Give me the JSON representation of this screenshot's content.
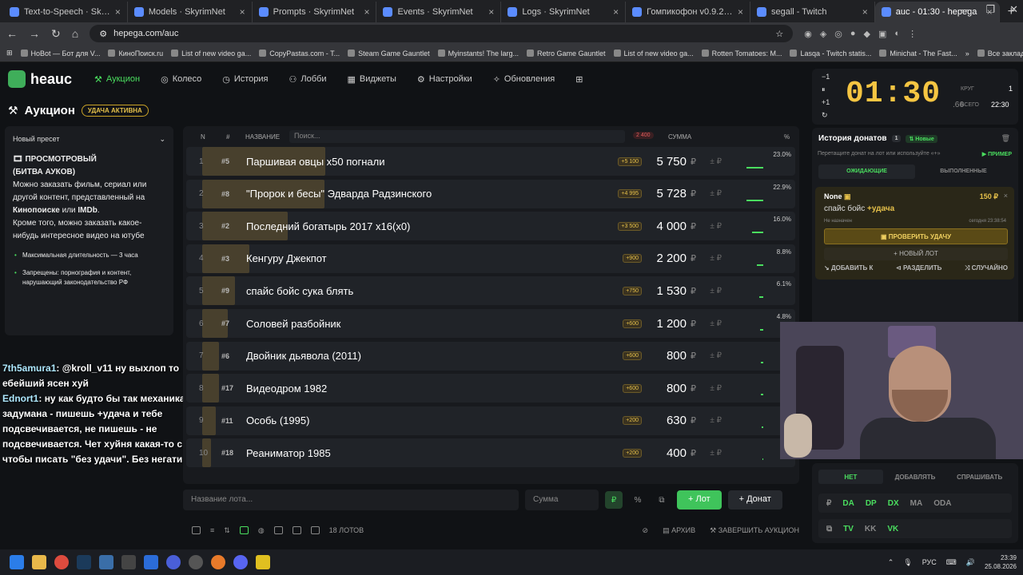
{
  "tabs": [
    {
      "title": "Text-to-Speech · SkyrimNet",
      "active": false
    },
    {
      "title": "Models · SkyrimNet",
      "active": false
    },
    {
      "title": "Prompts · SkyrimNet",
      "active": false
    },
    {
      "title": "Events · SkyrimNet",
      "active": false
    },
    {
      "title": "Logs · SkyrimNet",
      "active": false
    },
    {
      "title": "Гомпикофон v0.9.24.1 —",
      "active": false
    },
    {
      "title": "segall - Twitch",
      "active": false
    },
    {
      "title": "auc - 01:30 - hepega",
      "active": true
    }
  ],
  "url": "hepega.com/auc",
  "bookmarks": [
    "HoBot — Бот для V...",
    "КиноПоиск.ru",
    "List of new video ga...",
    "CopyPastas.com - T...",
    "Steam Game Gauntlet",
    "Myinstants! The larg...",
    "Retro Game Gauntlet",
    "List of new video ga...",
    "Rotten Tomatoes: M...",
    "Lasqa - Twitch statis...",
    "Minichat - The Fast..."
  ],
  "all_bookmarks": "Все закладки",
  "app": {
    "logo": "heauc",
    "nav": [
      "Аукцион",
      "Колесо",
      "История",
      "Лобби",
      "Виджеты",
      "Настройки",
      "Обновления"
    ],
    "page_title": "Аукцион",
    "luck_badge": "УДАЧА АКТИВНА"
  },
  "preset": {
    "name": "Новый пресет",
    "title1": "ПРОСМОТРОВЫЙ",
    "title2": "(БИТВА АУКОВ)",
    "text1": "Можно заказать фильм, сериал или другой контент, представленный на",
    "kp": "Кинопоиске",
    "or": "или",
    "imdb": "IMDb",
    "text2": "Кроме того, можно заказать какое-нибудь интересное видео на ютубе",
    "rule1": "Максимальная длительность — 3 часа",
    "rule2": "Запрещены: порнография и контент, нарушающий законодательство РФ"
  },
  "chat": [
    {
      "user": "7th5amura1",
      "text": "@kroll_v11 ну выхлоп то ебейший ясен хуй"
    },
    {
      "user": "Ednort1",
      "text": "ну как будто бы так механика и задумана - пишешь +удача и тебе подсвечивается, не пишешь - не подсвечивается. Чет хуйня какая-то с тем, чтобы писать \"без удачи\". Без негатива"
    }
  ],
  "table": {
    "headers": {
      "n": "N",
      "id": "#",
      "name": "НАЗВАНИЕ",
      "search": "Поиск...",
      "total": "2 400",
      "sum": "СУММА",
      "pct": "%"
    },
    "rows": [
      {
        "n": "1",
        "id": "#5",
        "name": "Паршивая овцы x50 погнали",
        "add": "+5 100",
        "amount": "5 750",
        "pct": "23.0%",
        "share": 0.23
      },
      {
        "n": "2",
        "id": "#8",
        "name": "\"Пророк и бесы\" Эдварда Радзинского",
        "add": "+4 995",
        "amount": "5 728",
        "pct": "22.9%",
        "share": 0.229
      },
      {
        "n": "3",
        "id": "#2",
        "name": "Последний богатырь 2017 x16(x0)",
        "add": "+3 500",
        "amount": "4 000",
        "pct": "16.0%",
        "share": 0.16
      },
      {
        "n": "4",
        "id": "#3",
        "name": "Кенгуру Джекпот",
        "add": "+900",
        "amount": "2 200",
        "pct": "8.8%",
        "share": 0.088
      },
      {
        "n": "5",
        "id": "#9",
        "name": "спайс бойс сука блять",
        "add": "+750",
        "amount": "1 530",
        "pct": "6.1%",
        "share": 0.061
      },
      {
        "n": "6",
        "id": "#7",
        "name": "Соловей разбойник",
        "add": "+600",
        "amount": "1 200",
        "pct": "4.8%",
        "share": 0.048
      },
      {
        "n": "7",
        "id": "#6",
        "name": "Двойник дьявола (2011)",
        "add": "+600",
        "amount": "800",
        "pct": "3.2",
        "share": 0.032
      },
      {
        "n": "8",
        "id": "#17",
        "name": "Видеодром 1982",
        "add": "+600",
        "amount": "800",
        "pct": "3.2",
        "share": 0.032
      },
      {
        "n": "9",
        "id": "#11",
        "name": "Особь (1995)",
        "add": "+200",
        "amount": "630",
        "pct": "2.5",
        "share": 0.025
      },
      {
        "n": "10",
        "id": "#18",
        "name": "Реаниматор 1985",
        "add": "+200",
        "amount": "400",
        "pct": "1.6",
        "share": 0.016
      }
    ],
    "currency": "₽",
    "plus": "± ₽"
  },
  "add_row": {
    "lot_placeholder": "Название лота...",
    "sum_placeholder": "Сумма",
    "cur1": "₽",
    "cur2": "%",
    "lot_btn": "+ Лот",
    "donat_btn": "+ Донат"
  },
  "footer": {
    "lots": "18 ЛОТОВ",
    "archive": "АРХИВ",
    "finish": "ЗАВЕРШИТЬ АУКЦИОН"
  },
  "timer": {
    "minus": "−1",
    "pause": "⏸",
    "plus": "+1",
    "value": "01:30",
    "ms": ".66",
    "round_label": "КРУГ",
    "round": "1",
    "total_label": "ВСЕГО",
    "total": "22:30"
  },
  "donations": {
    "title": "История донатов",
    "count": "1",
    "new": "Новые",
    "hint": "Перетащите донат на лот или используйте «+»",
    "example": "▶ ПРИМЕР",
    "tab_wait": "ОЖИДАЮЩИЕ",
    "tab_done": "ВЫПОЛНЕННЫЕ",
    "card": {
      "name": "None",
      "sum": "150 ₽",
      "msg": "спайс бойс",
      "luck": "+удача",
      "status": "Не назначен",
      "time": "сегодня 23:38:54",
      "check": "ПРОВЕРИТЬ УДАЧУ",
      "new_lot": "+ НОВЫЙ ЛОТ",
      "add_to": "ДОБАВИТЬ К",
      "split": "РАЗДЕЛИТЬ",
      "random": "СЛУЧАЙНО"
    }
  },
  "modes": [
    "НЕТ",
    "ДОБАВЛЯТЬ",
    "СПРАШИВАТЬ"
  ],
  "platforms1": [
    {
      "t": "₽",
      "on": false
    },
    {
      "t": "DA",
      "on": true
    },
    {
      "t": "DP",
      "on": true
    },
    {
      "t": "DX",
      "on": true
    },
    {
      "t": "MA",
      "on": false
    },
    {
      "t": "ODA",
      "on": false
    }
  ],
  "platforms2": [
    {
      "t": "TV",
      "on": true
    },
    {
      "t": "KK",
      "on": false
    },
    {
      "t": "VK",
      "on": true
    }
  ],
  "taskbar": {
    "lang": "РУС",
    "time": "23:39",
    "date": "25.08.2026"
  }
}
